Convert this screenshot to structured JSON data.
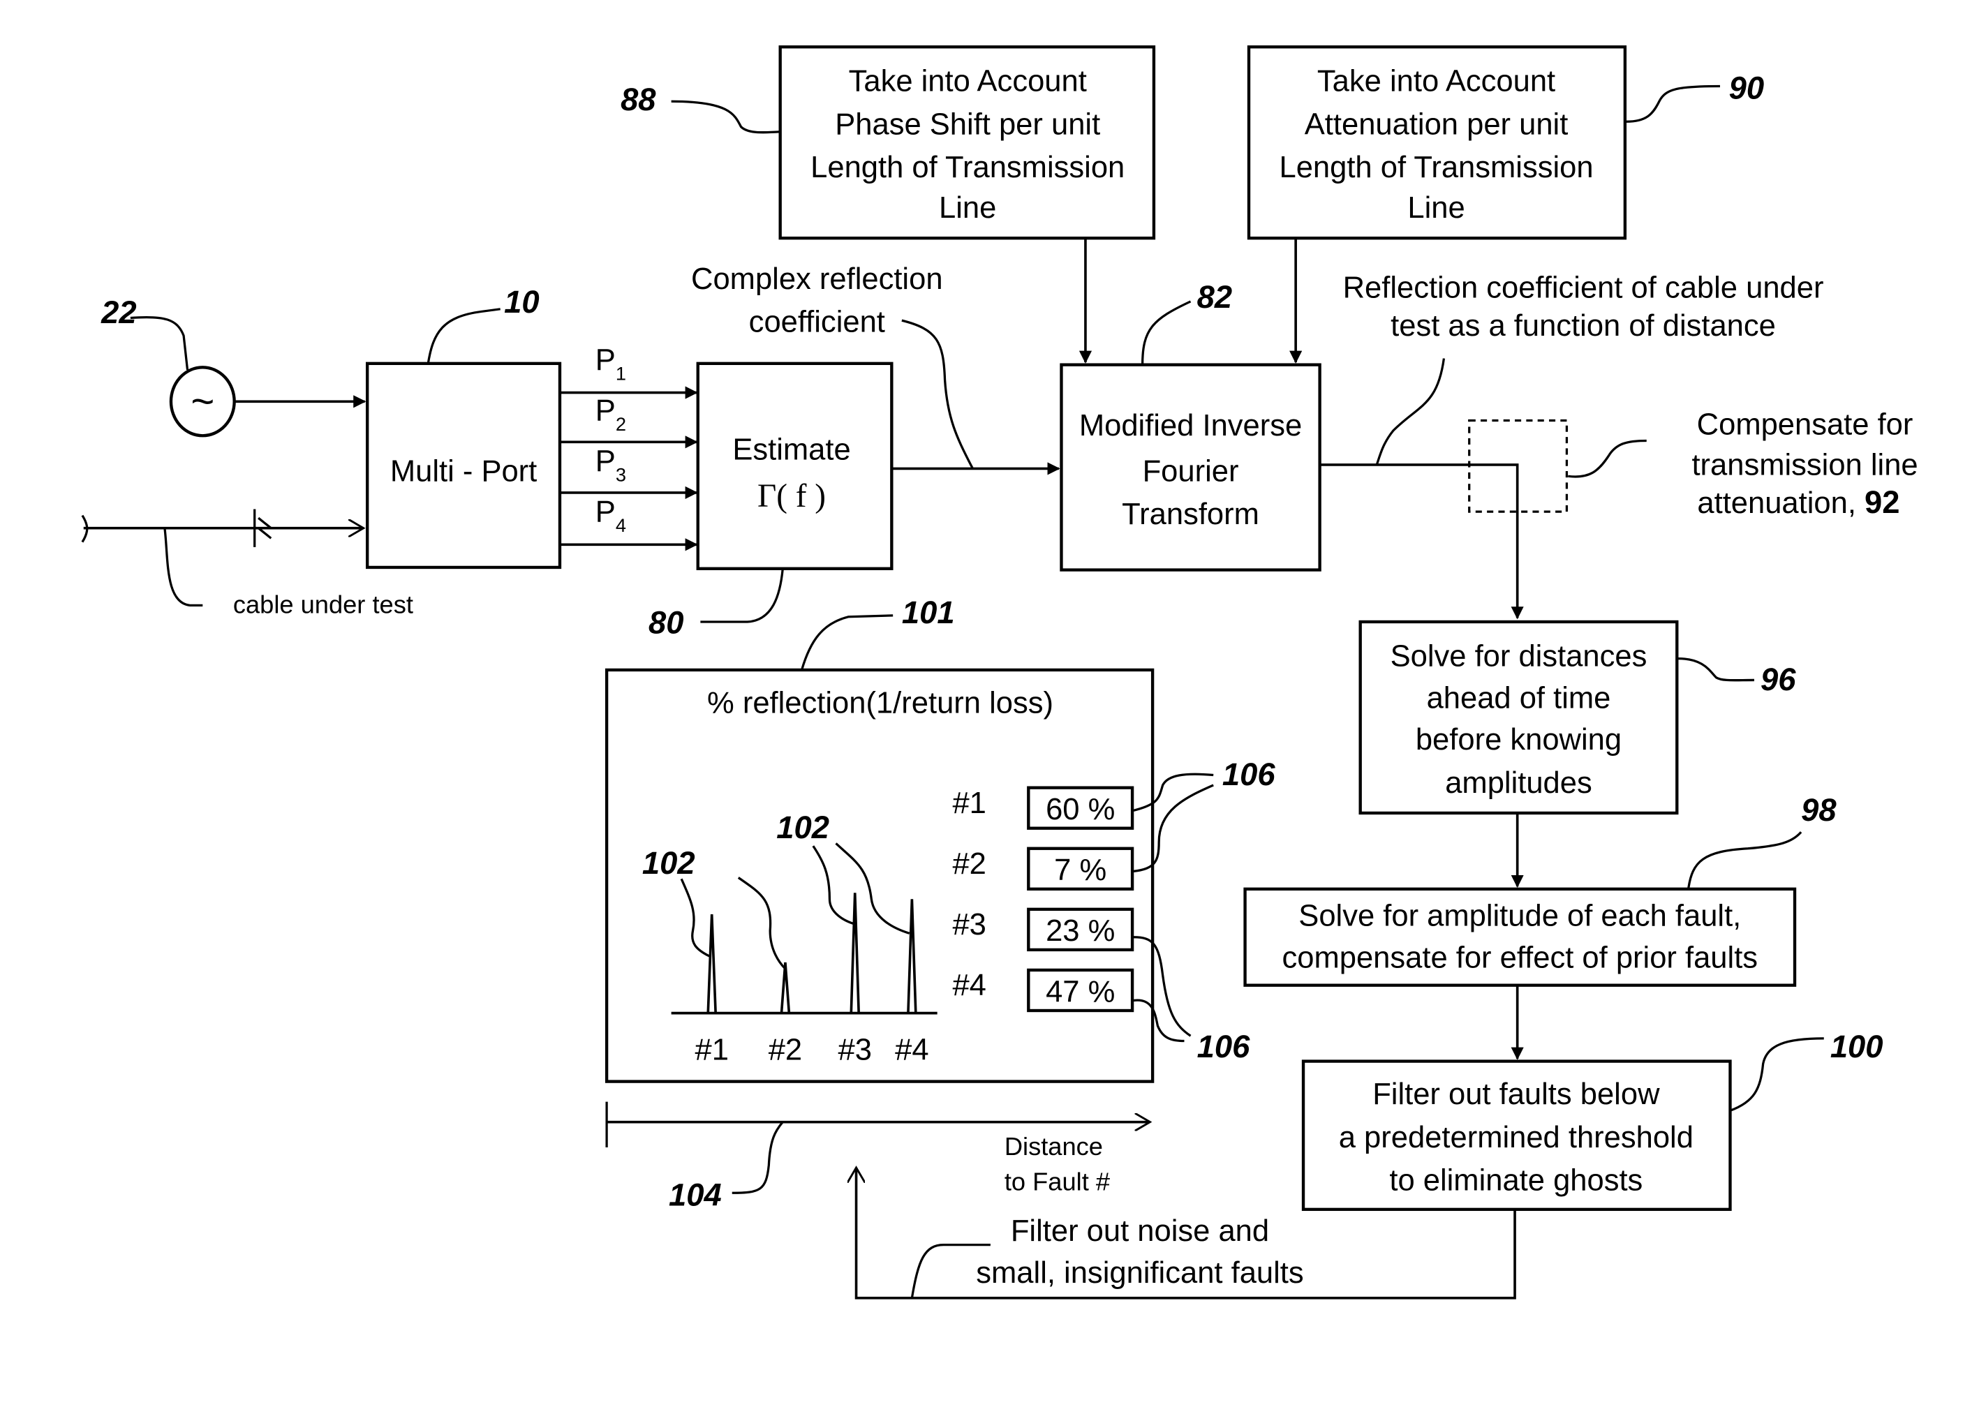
{
  "diagram": {
    "source_ref": "22",
    "multiport": {
      "ref": "10",
      "label": "Multi - Port"
    },
    "ports": [
      "P",
      "P",
      "P",
      "P"
    ],
    "port_subscripts": [
      "1",
      "2",
      "3",
      "4"
    ],
    "cable_label": "cable under test",
    "estimate": {
      "ref": "80",
      "line1": "Estimate",
      "line2": "Γ( f )"
    },
    "complex_reflection": {
      "line1": "Complex reflection",
      "line2": "coefficient"
    },
    "phase_box": {
      "ref": "88",
      "lines": [
        "Take into Account",
        "Phase Shift per unit",
        "Length of Transmission",
        "Line"
      ]
    },
    "atten_box": {
      "ref": "90",
      "lines": [
        "Take into Account",
        "Attenuation per unit",
        "Length of Transmission",
        "Line"
      ]
    },
    "mift": {
      "ref": "82",
      "lines": [
        "Modified Inverse",
        "Fourier",
        "Transform"
      ]
    },
    "reflection_fn": {
      "line1": "Reflection coefficient of cable under",
      "line2": "test as a function of distance"
    },
    "compensate": {
      "line1": "Compensate for",
      "line2": "transmission line",
      "line3": "attenuation,",
      "ref": "92"
    },
    "solve_dist": {
      "ref": "96",
      "lines": [
        "Solve for distances",
        "ahead of time",
        "before knowing",
        "amplitudes"
      ]
    },
    "solve_amp": {
      "ref": "98",
      "lines": [
        "Solve for amplitude of each fault,",
        "compensate for effect of prior faults"
      ]
    },
    "filter_box": {
      "ref": "100",
      "lines": [
        "Filter out faults below",
        "a predetermined threshold",
        "to eliminate ghosts"
      ]
    },
    "filter_noise": {
      "line1": "Filter out noise and",
      "line2": "small, insignificant faults"
    },
    "display": {
      "ref": "101",
      "title": "% reflection(1/return loss)",
      "spike_ref": "102",
      "value_ref": "106",
      "axis_ref": "104",
      "axis_label1": "Distance",
      "axis_label2": "to Fault #"
    }
  },
  "chart_data": {
    "type": "bar",
    "title": "% reflection(1/return loss)",
    "xlabel": "Distance to Fault #",
    "ylabel": "",
    "categories": [
      "#1",
      "#2",
      "#3",
      "#4"
    ],
    "values": [
      60,
      7,
      23,
      47
    ],
    "value_labels": [
      "60 %",
      "7 %",
      "23 %",
      "47 %"
    ]
  }
}
